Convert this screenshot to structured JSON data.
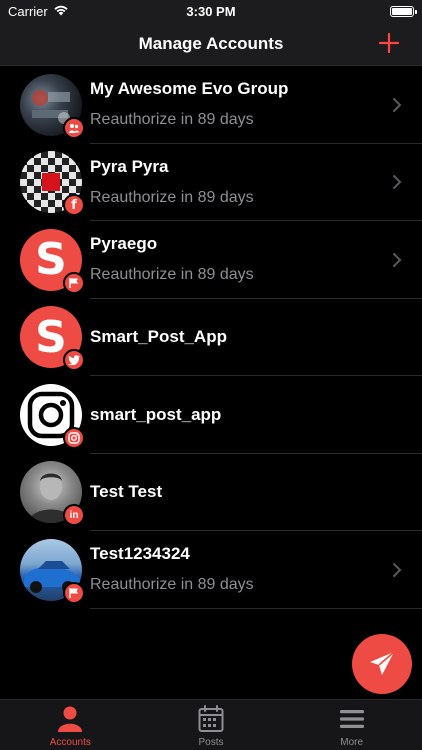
{
  "status_bar": {
    "carrier": "Carrier",
    "time": "3:30 PM"
  },
  "nav": {
    "title": "Manage Accounts",
    "add_label": "+"
  },
  "accounts": [
    {
      "name": "My Awesome Evo Group",
      "subtitle": "Reauthorize in 89 days",
      "platform": "facebook-group",
      "badge_glyph": "👥"
    },
    {
      "name": "Pyra Pyra",
      "subtitle": "Reauthorize in 89 days",
      "platform": "facebook",
      "badge_glyph": "f"
    },
    {
      "name": "Pyraego",
      "subtitle": "Reauthorize in 89 days",
      "platform": "page",
      "badge_glyph": "⚑"
    },
    {
      "name": "Smart_Post_App",
      "subtitle": "",
      "platform": "twitter",
      "badge_glyph": "🐦"
    },
    {
      "name": "smart_post_app",
      "subtitle": "",
      "platform": "instagram",
      "badge_glyph": "◎"
    },
    {
      "name": "Test Test",
      "subtitle": "",
      "platform": "linkedin",
      "badge_glyph": "in"
    },
    {
      "name": "Test1234324",
      "subtitle": "Reauthorize in 89 days",
      "platform": "page",
      "badge_glyph": "⚑"
    }
  ],
  "avatar_letter": "S",
  "tabs": [
    {
      "label": "Accounts",
      "icon": "person-icon",
      "active": true
    },
    {
      "label": "Posts",
      "icon": "calendar-icon",
      "active": false
    },
    {
      "label": "More",
      "icon": "menu-icon",
      "active": false
    }
  ],
  "colors": {
    "accent": "#ee4b44",
    "background": "#000000",
    "bar": "#1c1c1e",
    "subtext": "#8e8e93"
  }
}
